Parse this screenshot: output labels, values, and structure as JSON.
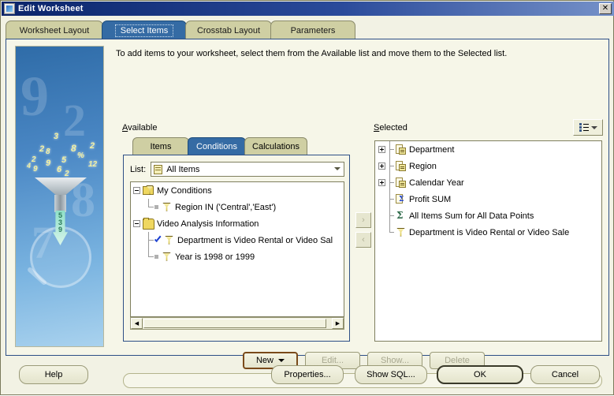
{
  "window": {
    "title": "Edit Worksheet",
    "title_icon": "app-icon",
    "close_label": "✕"
  },
  "tabs": [
    {
      "label": "Worksheet Layout",
      "active": false
    },
    {
      "label": "Select Items",
      "active": true
    },
    {
      "label": "Crosstab Layout",
      "active": false
    },
    {
      "label": "Parameters",
      "active": false
    }
  ],
  "intro": "To add items to your worksheet, select them from the Available list and move them to the Selected list.",
  "available": {
    "label": "Available",
    "tabs": [
      {
        "label": "Items",
        "active": false
      },
      {
        "label": "Conditions",
        "active": true
      },
      {
        "label": "Calculations",
        "active": false
      }
    ],
    "list_label": "List:",
    "list_value": "All Items",
    "list_icon": "document-icon",
    "tree": [
      {
        "label": "My Conditions",
        "icon": "folder-funnel-icon",
        "level": 0,
        "expanded": true,
        "checked": false
      },
      {
        "label": "Region IN ('Central','East')",
        "icon": "funnel-icon",
        "level": 1,
        "checked": false,
        "last": true
      },
      {
        "label": "Video Analysis Information",
        "icon": "folder-icon",
        "level": 0,
        "expanded": true,
        "checked": false
      },
      {
        "label": "Department is Video Rental or Video Sal",
        "icon": "funnel-icon",
        "level": 1,
        "checked": true
      },
      {
        "label": "Year is 1998 or 1999",
        "icon": "funnel-icon",
        "level": 1,
        "checked": false,
        "last": true
      }
    ],
    "scroll": {
      "left_arrow": "◀",
      "right_arrow": "▶"
    }
  },
  "move_buttons": [
    {
      "label": "›",
      "name": "move-right-button",
      "enabled": false
    },
    {
      "label": "‹",
      "name": "move-left-button",
      "enabled": false
    }
  ],
  "selected": {
    "label": "Selected",
    "view_button_icon": "list-view-icon",
    "tree": [
      {
        "label": "Department",
        "icon": "item-icon",
        "expandable": true
      },
      {
        "label": "Region",
        "icon": "item-icon",
        "expandable": true
      },
      {
        "label": "Calendar Year",
        "icon": "item-icon",
        "expandable": true
      },
      {
        "label": "Profit SUM",
        "icon": "sum-icon",
        "expandable": false
      },
      {
        "label": "All Items Sum for All Data Points",
        "icon": "total-icon",
        "expandable": false
      },
      {
        "label": "Department is Video Rental or Video Sale",
        "icon": "funnel-icon",
        "expandable": false,
        "last": true
      }
    ]
  },
  "action_buttons": [
    {
      "label": "New",
      "accesskey": "w",
      "dropdown": true,
      "enabled": true,
      "default": true
    },
    {
      "label": "Edit...",
      "accesskey": "E",
      "enabled": false
    },
    {
      "label": "Show...",
      "accesskey": "S",
      "enabled": false
    },
    {
      "label": "Delete",
      "accesskey": "D",
      "enabled": false
    }
  ],
  "status_text": "",
  "footer_buttons": [
    {
      "label": "Help",
      "accesskey": "H",
      "default": false
    },
    {
      "label": "Properties...",
      "accesskey": "P",
      "default": false
    },
    {
      "label": "Show SQL...",
      "accesskey": "Q",
      "default": false
    },
    {
      "label": "OK",
      "default": true
    },
    {
      "label": "Cancel",
      "default": false
    }
  ],
  "art": {
    "numbers": [
      "3",
      "8",
      "2",
      "2",
      "8",
      "%",
      "2",
      "9",
      "5",
      "12",
      "9",
      "6",
      "2",
      "9"
    ],
    "arrow_digits": [
      "5",
      "3",
      "9"
    ]
  }
}
